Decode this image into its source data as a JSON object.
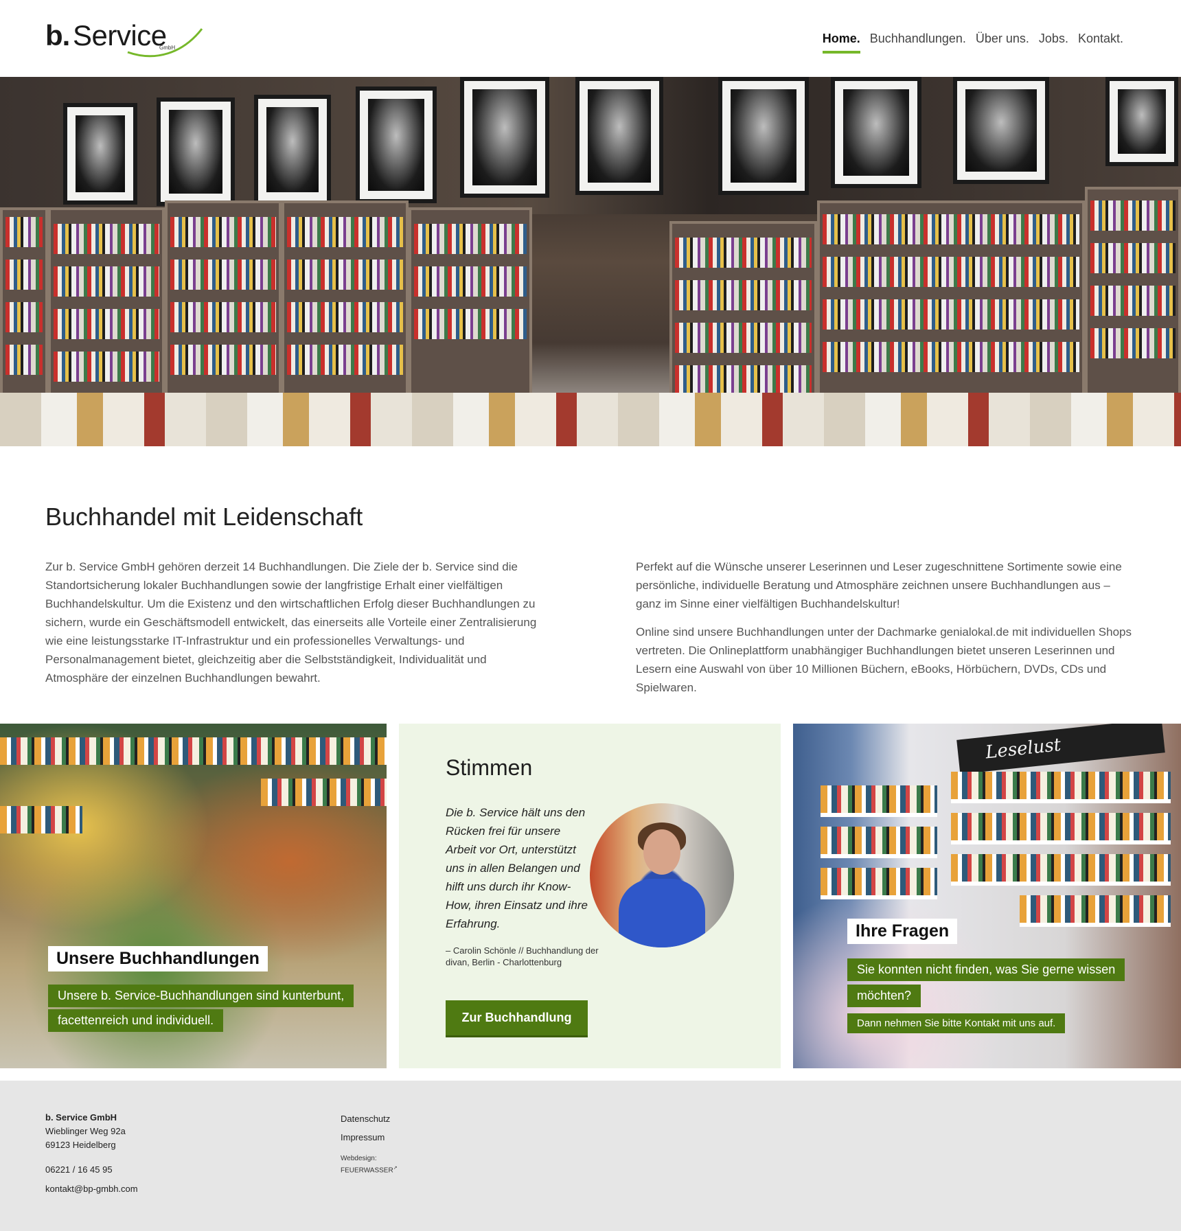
{
  "header": {
    "logo": {
      "b": "b.",
      "service": "Service",
      "gmbh": "GmbH"
    },
    "nav": [
      {
        "label": "Home."
      },
      {
        "label": "Buchhandlungen."
      },
      {
        "label": "Über uns."
      },
      {
        "label": "Jobs."
      },
      {
        "label": "Kontakt."
      }
    ]
  },
  "intro": {
    "title": "Buchhandel mit Leidenschaft",
    "left_paragraph": "Zur b. Service GmbH gehören derzeit 14 Buchhandlungen. Die Ziele der b. Service sind die Standortsicherung lokaler Buchhandlungen sowie der langfristige Erhalt einer vielfältigen Buchhandelskultur. Um die Existenz und den wirtschaftlichen Erfolg dieser Buchhandlungen zu sichern, wurde ein Geschäftsmodell entwickelt, das einerseits alle Vorteile einer Zentralisierung wie eine leistungsstarke IT-Infrastruktur und ein professionelles Verwaltungs- und Personalmanagement bietet, gleichzeitig aber die Selbstständigkeit, Individualität und Atmosphäre der einzelnen Buchhandlungen bewahrt.",
    "right_paragraph_1": "Perfekt auf die Wünsche unserer Leserinnen und Leser zugeschnittene Sortimente sowie eine persönliche, individuelle Beratung und Atmosphäre zeichnen unsere Buchhandlungen aus – ganz im Sinne einer vielfältigen Buchhandelskultur!",
    "right_paragraph_2": "Online sind unsere Buchhandlungen unter der Dachmarke genialokal.de mit individuellen Shops vertreten. Die Onlineplattform unabhängiger Buchhandlungen bietet unseren Leserinnen und Lesern eine Auswahl von über 10 Millionen Büchern, eBooks, Hörbüchern, DVDs, CDs und Spielwaren."
  },
  "tiles": {
    "stores": {
      "title": "Unsere Buchhandlungen",
      "line_1": "Unsere b. Service-Buchhandlungen sind kunterbunt,",
      "line_2": "facettenreich und individuell."
    },
    "voices": {
      "title": "Stimmen",
      "quote": "Die b. Service hält uns den Rücken frei für unsere Arbeit vor Ort, unterstützt uns in allen Belangen und hilft uns durch ihr Know-How, ihren Einsatz und ihre Erfahrung.",
      "attribution": "– Carolin Schönle // Buchhandlung der divan, Berlin - Charlottenburg",
      "button": "Zur Buchhandlung"
    },
    "questions": {
      "board": "Leselust",
      "title": "Ihre Fragen",
      "line_1": "Sie konnten nicht finden, was Sie gerne wissen",
      "line_2": "möchten?",
      "line_3": "Dann nehmen Sie bitte Kontakt mit uns auf."
    }
  },
  "footer": {
    "company": "b. Service GmbH",
    "street": "Wieblinger Weg 92a",
    "city": "69123 Heidelberg",
    "phone": "06221 / 16 45 95",
    "email": "kontakt@bp-gmbh.com",
    "links": [
      {
        "label": "Datenschutz"
      },
      {
        "label": "Impressum"
      }
    ],
    "credit_label": "Webdesign:",
    "credit": "FEUERWASSER"
  },
  "colors": {
    "accent": "#76b82a",
    "button_green": "#4f7a12",
    "tile_bg": "#eef5e6",
    "footer_bg": "#e6e6e6"
  }
}
